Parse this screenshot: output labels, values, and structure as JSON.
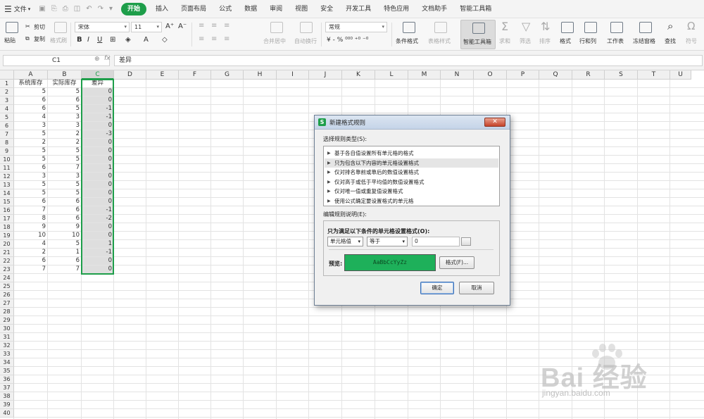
{
  "menubar": {
    "file_label": "文件",
    "tabs": [
      {
        "label": "开始",
        "active": true
      },
      {
        "label": "插入"
      },
      {
        "label": "页面布局"
      },
      {
        "label": "公式"
      },
      {
        "label": "数据"
      },
      {
        "label": "审阅"
      },
      {
        "label": "视图"
      },
      {
        "label": "安全"
      },
      {
        "label": "开发工具"
      },
      {
        "label": "特色应用"
      },
      {
        "label": "文档助手"
      },
      {
        "label": "智能工具箱"
      }
    ]
  },
  "ribbon": {
    "paste": "粘贴",
    "cut": "剪切",
    "copy": "复制",
    "format_painter": "格式刷",
    "font_name": "宋体",
    "font_size": "11",
    "merge_center": "合并居中",
    "auto_wrap": "自动换行",
    "number_format": "常规",
    "conditional_format": "条件格式",
    "table_style": "表格样式",
    "smart_toolbox": "智能工具箱",
    "sum": "求和",
    "filter": "筛选",
    "sort": "排序",
    "format": "格式",
    "rows_cols": "行和列",
    "worksheet": "工作表",
    "freeze": "冻结窗格",
    "find": "查找",
    "symbol": "符号"
  },
  "formula_bar": {
    "cell_ref": "C1",
    "fx": "fx",
    "content": "差异"
  },
  "sheet": {
    "columns": [
      "A",
      "B",
      "C",
      "D",
      "E",
      "F",
      "G",
      "H",
      "I",
      "J",
      "K",
      "L",
      "M",
      "N",
      "O",
      "P",
      "Q",
      "R",
      "S",
      "T",
      "U"
    ],
    "selected_column": "C",
    "rows": [
      "1",
      "2",
      "3",
      "4",
      "5",
      "6",
      "7",
      "8",
      "9",
      "10",
      "11",
      "12",
      "13",
      "14",
      "15",
      "16",
      "17",
      "18",
      "19",
      "20",
      "21",
      "22",
      "23",
      "24",
      "25",
      "26",
      "27",
      "28",
      "29",
      "30",
      "31",
      "32",
      "33",
      "34",
      "35",
      "36",
      "37",
      "38",
      "39",
      "40"
    ],
    "headers": [
      "系统库存",
      "实际库存",
      "差异"
    ],
    "data": [
      [
        "5",
        "5",
        "0"
      ],
      [
        "6",
        "6",
        "0"
      ],
      [
        "6",
        "5",
        "-1"
      ],
      [
        "4",
        "3",
        "-1"
      ],
      [
        "3",
        "3",
        "0"
      ],
      [
        "5",
        "2",
        "-3"
      ],
      [
        "2",
        "2",
        "0"
      ],
      [
        "5",
        "5",
        "0"
      ],
      [
        "5",
        "5",
        "0"
      ],
      [
        "6",
        "7",
        "1"
      ],
      [
        "3",
        "3",
        "0"
      ],
      [
        "5",
        "5",
        "0"
      ],
      [
        "5",
        "5",
        "0"
      ],
      [
        "6",
        "6",
        "0"
      ],
      [
        "7",
        "6",
        "-1"
      ],
      [
        "8",
        "6",
        "-2"
      ],
      [
        "9",
        "9",
        "0"
      ],
      [
        "10",
        "10",
        "0"
      ],
      [
        "4",
        "5",
        "1"
      ],
      [
        "2",
        "1",
        "-1"
      ],
      [
        "6",
        "6",
        "0"
      ],
      [
        "7",
        "7",
        "0"
      ]
    ]
  },
  "dialog": {
    "title": "新建格式规则",
    "close": "✕",
    "select_rule_type": "选择规则类型(S):",
    "rule_types": [
      "基于各自值设置所有单元格的格式",
      "只为包含以下内容的单元格设置格式",
      "仅对排名靠前或靠后的数值设置格式",
      "仅对高于或低于平均值的数值设置格式",
      "仅对唯一值或重复值设置格式",
      "使用公式确定要设置格式的单元格"
    ],
    "selected_rule_index": 1,
    "edit_rule_desc": "编辑规则说明(E):",
    "condition_label": "只为满足以下条件的单元格设置格式(O):",
    "condition_type": "单元格值",
    "operator": "等于",
    "value": "0",
    "preview_label": "预览:",
    "preview_text": "AaBbCcYyZz",
    "format_button": "格式(F)...",
    "ok": "确定",
    "cancel": "取消"
  },
  "watermark": {
    "brand": "Bai 经验",
    "url": "jingyan.baidu.com"
  },
  "colors": {
    "accent": "#1e9e4a",
    "preview_fill": "#1eb05a"
  }
}
